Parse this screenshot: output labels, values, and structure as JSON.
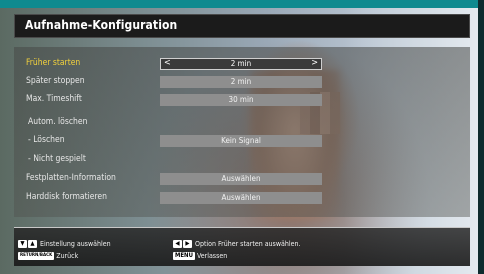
{
  "window": {
    "title": "Aufnahme-Konfiguration"
  },
  "menu": {
    "items": [
      {
        "label": "Früher starten",
        "value": "2 min",
        "selected": true
      },
      {
        "label": "Später stoppen",
        "value": "2 min"
      },
      {
        "label": "Max. Timeshift",
        "value": "30 min"
      },
      {
        "label": "Autom. löschen"
      },
      {
        "label": "- Löschen",
        "value": "Kein Signal"
      },
      {
        "label": "- Nicht gespielt"
      },
      {
        "label": "Festplatten-Information",
        "value": "Auswählen"
      },
      {
        "label": "Harddisk formatieren",
        "value": "Auswählen"
      }
    ],
    "arrows": {
      "left": "<",
      "right": ">"
    }
  },
  "help": {
    "navigate_text": "Einstellung auswählen",
    "back_key": "RETURN/BACK",
    "back_text": "Zurück",
    "option_text": "Option Früher starten auswählen.",
    "menu_key": "MENU",
    "menu_text": "Verlassen"
  },
  "icons": [
    "down-up-arrows-icon",
    "left-right-arrows-icon"
  ]
}
